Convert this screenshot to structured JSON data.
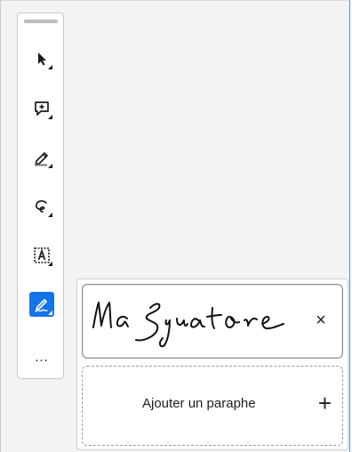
{
  "toolbar": {
    "tools": [
      {
        "name": "select-tool",
        "icon": "arrow-pointer-icon"
      },
      {
        "name": "comment-tool",
        "icon": "comment-add-icon"
      },
      {
        "name": "highlight-tool",
        "icon": "marker-icon"
      },
      {
        "name": "draw-tool",
        "icon": "lasso-icon"
      },
      {
        "name": "text-select-tool",
        "icon": "text-box-icon"
      },
      {
        "name": "sign-tool",
        "icon": "signature-pen-icon",
        "active": true
      }
    ],
    "more_label": "…"
  },
  "signature_panel": {
    "signature_text": "Ma Signature",
    "remove_symbol": "×",
    "add_initials_label": "Ajouter un paraphe",
    "add_symbol": "+"
  },
  "colors": {
    "accent": "#1473e6"
  }
}
